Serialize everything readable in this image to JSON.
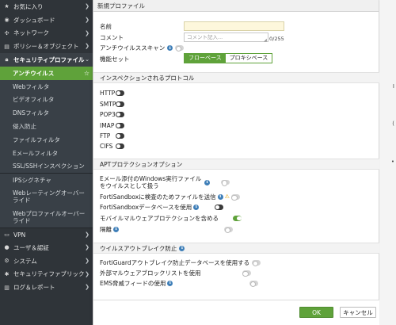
{
  "sidebar": {
    "top_items": [
      {
        "label": "お気に入り",
        "icon": "star-icon"
      },
      {
        "label": "ダッシュボード",
        "icon": "dashboard-icon"
      },
      {
        "label": "ネットワーク",
        "icon": "network-icon"
      },
      {
        "label": "ポリシー＆オブジェクト",
        "icon": "policy-icon"
      },
      {
        "label": "セキュリティプロファイル",
        "icon": "lock-icon"
      }
    ],
    "sub_items": [
      {
        "label": "アンチウイルス"
      },
      {
        "label": "Webフィルタ"
      },
      {
        "label": "ビデオフィルタ"
      },
      {
        "label": "DNSフィルタ"
      },
      {
        "label": "侵入防止"
      },
      {
        "label": "ファイルフィルタ"
      },
      {
        "label": "Eメールフィルタ"
      },
      {
        "label": "SSL/SSHインスペクション"
      },
      {
        "label": "IPSシグネチャ"
      },
      {
        "label": "Webレーティングオーバーライド"
      },
      {
        "label": "Webプロファイルオーバーライド"
      }
    ],
    "bottom_items": [
      {
        "label": "VPN",
        "icon": "vpn-icon"
      },
      {
        "label": "ユーザ＆認証",
        "icon": "user-icon"
      },
      {
        "label": "システム",
        "icon": "gear-icon"
      },
      {
        "label": "セキュリティファブリック",
        "icon": "fabric-icon"
      },
      {
        "label": "ログ＆レポート",
        "icon": "chart-icon"
      }
    ]
  },
  "dialog": {
    "title": "新規プロファイル",
    "name_label": "名前",
    "name_value": "",
    "comment_label": "コメント",
    "comment_placeholder": "コメント記入...",
    "comment_counter": "0/255",
    "antivirus_scan_label": "アンチウイルススキャン",
    "feature_set_label": "機能セット",
    "feature_flow": "フローベース",
    "feature_proxy": "プロキシベース",
    "inspected_protocols_title": "インスペクションされるプロトコル",
    "protocols": [
      "HTTP",
      "SMTP",
      "POP3",
      "IMAP",
      "FTP",
      "CIFS"
    ],
    "apt_title": "APTプロテクションオプション",
    "apt_options": [
      {
        "label": "Eメール添付のWindows実行ファイルをウイルスとして扱う",
        "info": true,
        "warn": false,
        "state": "off"
      },
      {
        "label": "FortiSandboxに検査のためファイルを送信",
        "info": true,
        "warn": true,
        "state": "dark"
      },
      {
        "label": "FortiSandboxデータベースを使用",
        "info": true,
        "warn": false,
        "state": "dark"
      },
      {
        "label": "モバイルマルウェアプロテクションを含める",
        "info": false,
        "warn": false,
        "state": "on"
      },
      {
        "label": "隔離",
        "info": true,
        "warn": false,
        "state": "off"
      }
    ],
    "outbreak_title": "ウイルスアウトブレイク防止",
    "outbreak_options": [
      {
        "label": "FortiGuardアウトブレイク防止データベースを使用する",
        "info": false
      },
      {
        "label": "外部マルウェアブロックリストを使用",
        "info": false
      },
      {
        "label": "EMS脅威フィードの使用",
        "info": true
      }
    ],
    "ok_label": "OK",
    "cancel_label": "キャンセル"
  },
  "colors": {
    "accent": "#5fa23a",
    "sidebar_bg": "#2f3439",
    "info": "#3f7fb8"
  }
}
